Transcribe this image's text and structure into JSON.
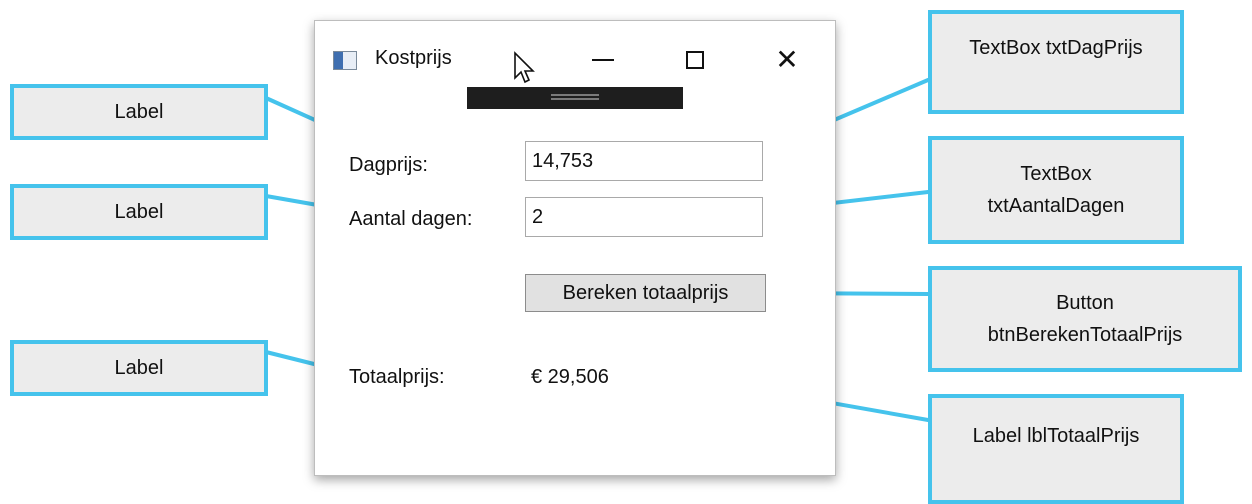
{
  "window": {
    "title": "Kostprijs",
    "icons": {
      "app": "app-window-icon",
      "cursor": "mouse-pointer-icon",
      "minimize": "minimize-icon",
      "maximize": "maximize-icon",
      "close": "close-icon",
      "drag": "drag-handle-icon"
    },
    "fields": {
      "dagprijs_label": "Dagprijs:",
      "dagprijs_value": "14,753",
      "aantal_label": "Aantal dagen:",
      "aantal_value": "2",
      "button_label": "Bereken totaalprijs",
      "totaal_label": "Totaalprijs:",
      "totaal_value": "€ 29,506"
    }
  },
  "callouts": {
    "left_1": "Label",
    "left_2": "Label",
    "left_3": "Label",
    "right_1": "TextBox txtDagPrijs",
    "right_2_line1": "TextBox",
    "right_2_line2": "txtAantalDagen",
    "right_3_line1": "Button",
    "right_3_line2": "btnBerekenTotaalPrijs",
    "right_4": "Label lblTotaalPrijs"
  },
  "colors": {
    "callout_border": "#45c3ec",
    "callout_fill": "#ececec",
    "connector": "#45c3ec"
  }
}
